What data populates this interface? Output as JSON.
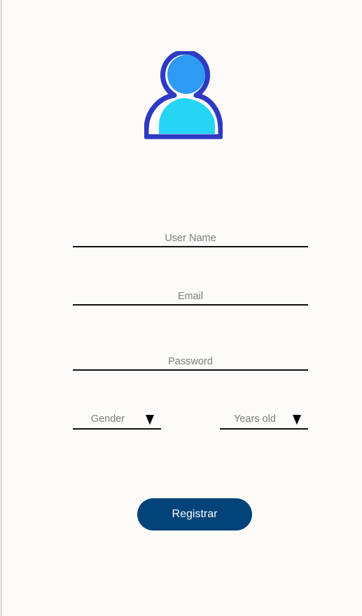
{
  "header": {
    "avatar_icon": "user-profile-icon",
    "colors": {
      "outline": "#2e3ac4",
      "head": "#2e9bf2",
      "body": "#25d5f3"
    }
  },
  "form": {
    "username_placeholder": "User Name",
    "email_placeholder": "Email",
    "password_placeholder": "Password",
    "gender": {
      "label": "Gender",
      "icon": "dropdown-arrow-icon"
    },
    "age": {
      "label": "Years old",
      "icon": "dropdown-arrow-icon"
    },
    "submit_label": "Registrar",
    "submit_color": "#02437a"
  }
}
